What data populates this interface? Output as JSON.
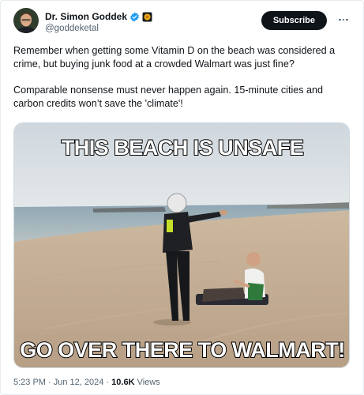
{
  "author": {
    "display_name": "Dr. Simon Goddek",
    "handle": "@goddeketal"
  },
  "subscribe_label": "Subscribe",
  "tweet": {
    "paragraph_1": "Remember when getting some Vitamin D on the beach was considered a crime, but buying junk food at a crowded Walmart was just fine?",
    "paragraph_2": "Comparable nonsense must never happen again. 15-minute cities and carbon credits won’t save the 'climate'!"
  },
  "meme": {
    "top_caption": "THIS BEACH IS UNSAFE",
    "bottom_caption": "GO OVER THERE TO WALMART!"
  },
  "meta": {
    "time": "5:23 PM",
    "separator": " · ",
    "date": "Jun 12, 2024",
    "views_count": "10.6K",
    "views_label": " Views"
  },
  "colors": {
    "verified_blue": "#1d9bf0",
    "text_primary": "#0f1419",
    "text_secondary": "#536471"
  }
}
